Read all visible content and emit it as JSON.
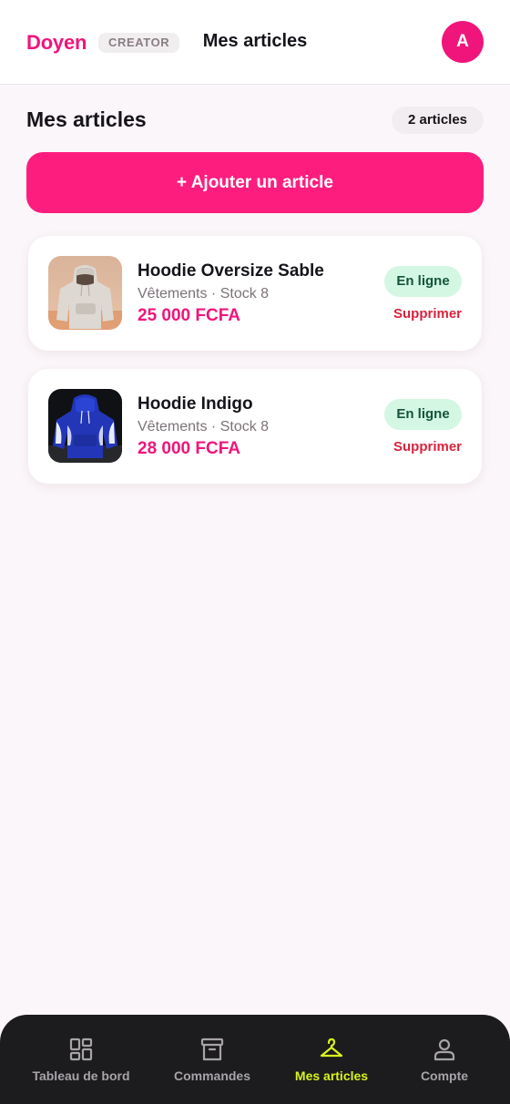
{
  "header": {
    "brand": "Doyen",
    "role_badge": "CREATOR",
    "title": "Mes articles",
    "avatar_initial": "A"
  },
  "section": {
    "title": "Mes articles",
    "count": "2 articles"
  },
  "add_button_label": "+ Ajouter un article",
  "products": [
    {
      "name": "Hoodie Oversize Sable",
      "meta": "Vêtements · Stock 8",
      "price": "25 000 FCFA",
      "status": "En ligne",
      "delete_label": "Supprimer",
      "image": "beige-hoodie-photo"
    },
    {
      "name": "Hoodie Indigo",
      "meta": "Vêtements · Stock 8",
      "price": "28 000 FCFA",
      "status": "En ligne",
      "delete_label": "Supprimer",
      "image": "blue-hoodie-photo"
    }
  ],
  "nav": {
    "items": [
      {
        "label": "Tableau de bord",
        "icon": "dashboard-grid-icon",
        "active": false
      },
      {
        "label": "Commandes",
        "icon": "archive-box-icon",
        "active": false
      },
      {
        "label": "Mes articles",
        "icon": "hanger-icon",
        "active": true
      },
      {
        "label": "Compte",
        "icon": "person-icon",
        "active": false
      }
    ]
  },
  "colors": {
    "brand": "#f0157b",
    "primary_button": "#fd1d7f",
    "status_bg": "#d4f7e3",
    "status_text": "#13553a",
    "delete": "#d8233e",
    "nav_bg": "#1c1c1e",
    "nav_active": "#d8f41c"
  }
}
